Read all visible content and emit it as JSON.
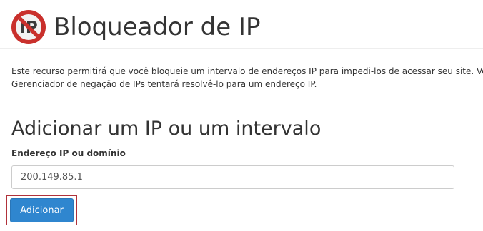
{
  "page": {
    "title": "Bloqueador de IP",
    "header_icon": "no-ip-icon"
  },
  "description": {
    "line1": "Este recurso permitirá que você bloqueie um intervalo de endereços IP para impedi-los de acessar seu site. Você também pode inserir um nome de domínio totalmente qualificado e o",
    "line2": "Gerenciador de negação de IPs tentará resolvê-lo para um endereço IP."
  },
  "add_section": {
    "title": "Adicionar um IP ou um intervalo",
    "field_label": "Endereço IP ou domínio",
    "field_value": "200.149.85.1",
    "submit_label": "Adicionar"
  },
  "colors": {
    "title_text": "#333333",
    "primary_button": "#2f86cf",
    "focus_outline": "#b0313a",
    "icon_red": "#c9302c",
    "icon_dark": "#3a3a3a"
  }
}
